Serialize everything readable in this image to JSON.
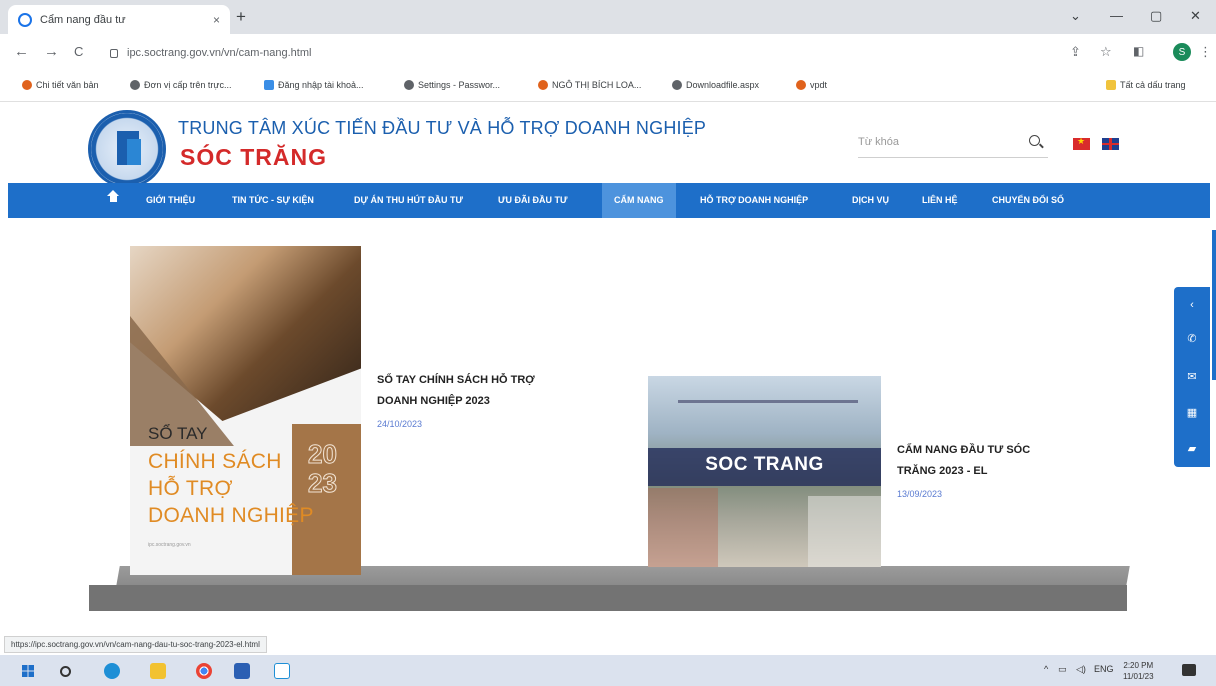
{
  "browser": {
    "tab_title": "Cẩm nang đầu tư",
    "tab_close": "×",
    "new_tab": "+",
    "window_controls": [
      "⌄",
      "—",
      "▢",
      "✕"
    ],
    "url": "ipc.soctrang.gov.vn/vn/cam-nang.html",
    "nav": {
      "back": "←",
      "forward": "→",
      "reload": "C"
    },
    "toolbar_icons": [
      "share-icon",
      "star-icon",
      "sidepanel-icon",
      "profile-icon",
      "menu-icon"
    ],
    "profile_initial": "S",
    "menu": "⋮",
    "bookmarks": [
      {
        "label": "Chi tiết văn bản",
        "color": "#e0621c"
      },
      {
        "label": "Đơn vị cấp trên trực...",
        "color": "#5f6368"
      },
      {
        "label": "Đăng nhập tài khoả...",
        "color": "#3a8ee6"
      },
      {
        "label": "Settings - Passwor...",
        "color": "#5f6368"
      },
      {
        "label": "NGÔ THỊ BÍCH LOA...",
        "color": "#e0621c"
      },
      {
        "label": "Downloadfile.aspx",
        "color": "#5f6368"
      },
      {
        "label": "vpdt",
        "color": "#e0621c"
      }
    ],
    "all_bookmarks": "Tất cả dấu trang",
    "status_url": "https://ipc.soctrang.gov.vn/vn/cam-nang-dau-tu-soc-trang-2023-el.html"
  },
  "site": {
    "title": "TRUNG TÂM XÚC TIẾN ĐẦU TƯ VÀ HỖ TRỢ DOANH NGHIỆP",
    "subtitle": "SÓC TRĂNG",
    "search_placeholder": "Từ khóa"
  },
  "menu": [
    {
      "label": "GIỚI THIỆU",
      "active": false
    },
    {
      "label": "TIN TỨC - SỰ KIỆN",
      "active": false
    },
    {
      "label": "DỰ ÁN THU HÚT ĐẦU TƯ",
      "active": false
    },
    {
      "label": "ƯU ĐÃI ĐẦU TƯ",
      "active": false
    },
    {
      "label": "CẨM NANG",
      "active": true
    },
    {
      "label": "HỖ TRỢ DOANH NGHIỆP",
      "active": false
    },
    {
      "label": "DỊCH VỤ",
      "active": false
    },
    {
      "label": "LIÊN HỆ",
      "active": false
    },
    {
      "label": "CHUYỂN ĐỔI SỐ",
      "active": false
    }
  ],
  "articles": [
    {
      "title_line1": "SỔ TAY CHÍNH SÁCH HỖ TRỢ",
      "title_line2": "DOANH NGHIỆP 2023",
      "date": "24/10/2023",
      "cover": {
        "heading": "SỔ TAY",
        "line1": "CHÍNH SÁCH",
        "line2": "HỖ TRỢ",
        "line3": "DOANH NGHIỆP",
        "year": "2023",
        "url": "ipc.soctrang.gov.vn"
      }
    },
    {
      "title_line1": "CẨM NANG ĐẦU TƯ SÓC",
      "title_line2": "TRĂNG 2023 - EL",
      "date": "13/09/2023",
      "cover": {
        "heading": "SOC TRANG"
      }
    }
  ],
  "contact_rail": [
    "chevron-left-icon",
    "phone-icon",
    "mail-icon",
    "calendar-icon",
    "chat-icon"
  ],
  "taskbar": {
    "tray_chevron": "^",
    "lang": "ENG",
    "time": "2:20 PM",
    "date": "11/01/23"
  }
}
